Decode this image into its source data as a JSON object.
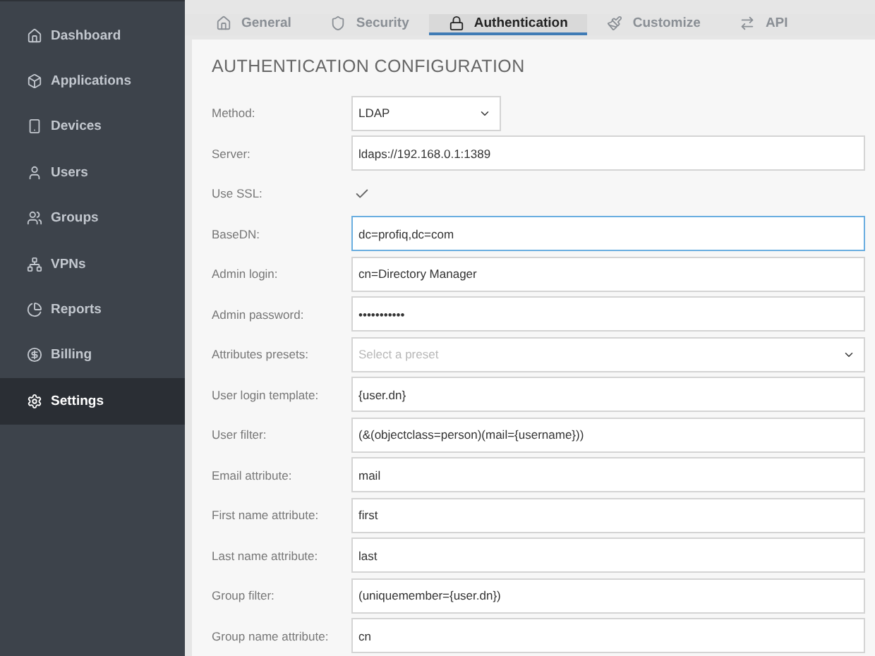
{
  "sidebar": {
    "items": [
      {
        "label": "Dashboard",
        "selected": false
      },
      {
        "label": "Applications",
        "selected": false
      },
      {
        "label": "Devices",
        "selected": false
      },
      {
        "label": "Users",
        "selected": false
      },
      {
        "label": "Groups",
        "selected": false
      },
      {
        "label": "VPNs",
        "selected": false
      },
      {
        "label": "Reports",
        "selected": false
      },
      {
        "label": "Billing",
        "selected": false
      },
      {
        "label": "Settings",
        "selected": true
      }
    ]
  },
  "tabs": [
    {
      "label": "General",
      "selected": false
    },
    {
      "label": "Security",
      "selected": false
    },
    {
      "label": "Authentication",
      "selected": true
    },
    {
      "label": "Customize",
      "selected": false
    },
    {
      "label": "API",
      "selected": false
    }
  ],
  "form": {
    "title": "AUTHENTICATION CONFIGURATION",
    "fields": [
      {
        "label": "Method:",
        "kind": "select",
        "value": "LDAP",
        "focused": false
      },
      {
        "label": "Server:",
        "kind": "text",
        "value": "ldaps://192.168.0.1:1389",
        "focused": false
      },
      {
        "label": "Use SSL:",
        "kind": "checkbox",
        "checked": true
      },
      {
        "label": "BaseDN:",
        "kind": "text",
        "value": "dc=profiq,dc=com",
        "focused": true
      },
      {
        "label": "Admin login:",
        "kind": "text",
        "value": "cn=Directory Manager",
        "focused": false
      },
      {
        "label": "Admin password:",
        "kind": "text",
        "value": "•••••••••••",
        "focused": false
      },
      {
        "label": "Attributes presets:",
        "kind": "preset",
        "placeholder": "Select a preset",
        "focused": false
      },
      {
        "label": "User login template:",
        "kind": "text",
        "value": "{user.dn}",
        "focused": false
      },
      {
        "label": "User filter:",
        "kind": "text",
        "value": "(&(objectclass=person)(mail={username}))",
        "focused": false
      },
      {
        "label": "Email attribute:",
        "kind": "text",
        "value": "mail",
        "focused": false
      },
      {
        "label": "First name attribute:",
        "kind": "text",
        "value": "first",
        "focused": false
      },
      {
        "label": "Last name attribute:",
        "kind": "text",
        "value": "last",
        "focused": false
      },
      {
        "label": "Group filter:",
        "kind": "text",
        "value": "(uniquemember={user.dn})",
        "focused": false
      },
      {
        "label": "Group name attribute:",
        "kind": "text",
        "value": "cn",
        "focused": false
      }
    ]
  }
}
